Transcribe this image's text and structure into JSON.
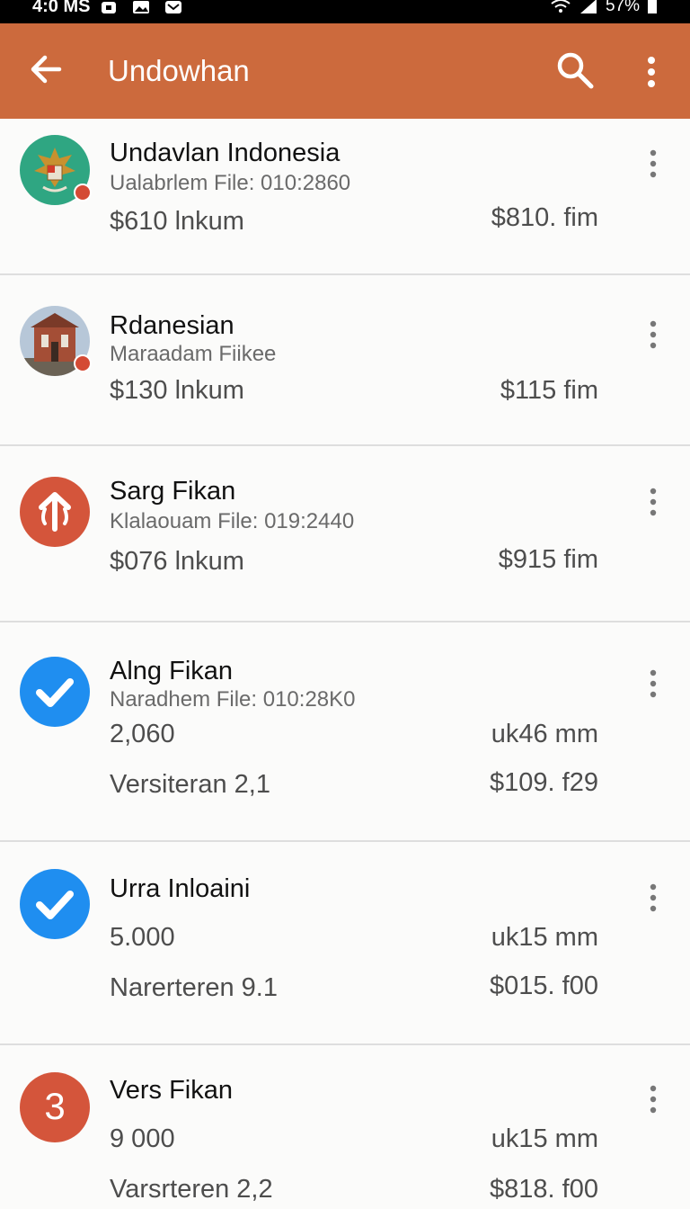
{
  "status_bar": {
    "time": "4:0 MS",
    "battery": "57%"
  },
  "app_bar": {
    "title": "Undowhan",
    "back_icon": "arrow-left-icon",
    "search_icon": "search-icon",
    "overflow_icon": "more-vertical-icon"
  },
  "items": [
    {
      "title": "Undavlan Indonesia",
      "subtitle": "Ualabrlem File: 010:2860",
      "left_value": "$610 lnkum",
      "right_value": "$810. fim",
      "avatar": "emblem-garuda",
      "badge_color": "#d44a34"
    },
    {
      "title": "Rdanesian",
      "subtitle": "Maraadam Fiikee",
      "left_value": "$130 lnkum",
      "right_value": "$115 fim",
      "avatar": "building-photo",
      "badge_color": "#d44a34"
    },
    {
      "title": "Sarg Fikan",
      "subtitle": "Klalaouam File: 019:2440",
      "left_value": "$076 lnkum",
      "right_value": "$915 fim",
      "avatar": "arrow-up-circle",
      "avatar_color": "#d4553b"
    },
    {
      "title": "Alng Fikan",
      "subtitle": "Naradhem File: 010:28K0",
      "left_value": "2,060",
      "right_value": "uk46 mm",
      "left_value_2": "Versiteran 2,1",
      "right_value_2": "$109. f29",
      "avatar": "check-circle",
      "avatar_color": "#1f8ef0"
    },
    {
      "title": "Urra Inloaini",
      "left_value": "5.000",
      "right_value": "uk15 mm",
      "left_value_2": "Narerteren 9.1",
      "right_value_2": "$015. f00",
      "avatar": "check-circle",
      "avatar_color": "#1f8ef0"
    },
    {
      "title": "Vers Fikan",
      "left_value": "9 000",
      "right_value": "uk15 mm",
      "left_value_2": "Varsrteren 2,2",
      "right_value_2": "$818. f00",
      "avatar": "number-badge",
      "avatar_text": "3",
      "avatar_color": "#d4553b"
    }
  ]
}
